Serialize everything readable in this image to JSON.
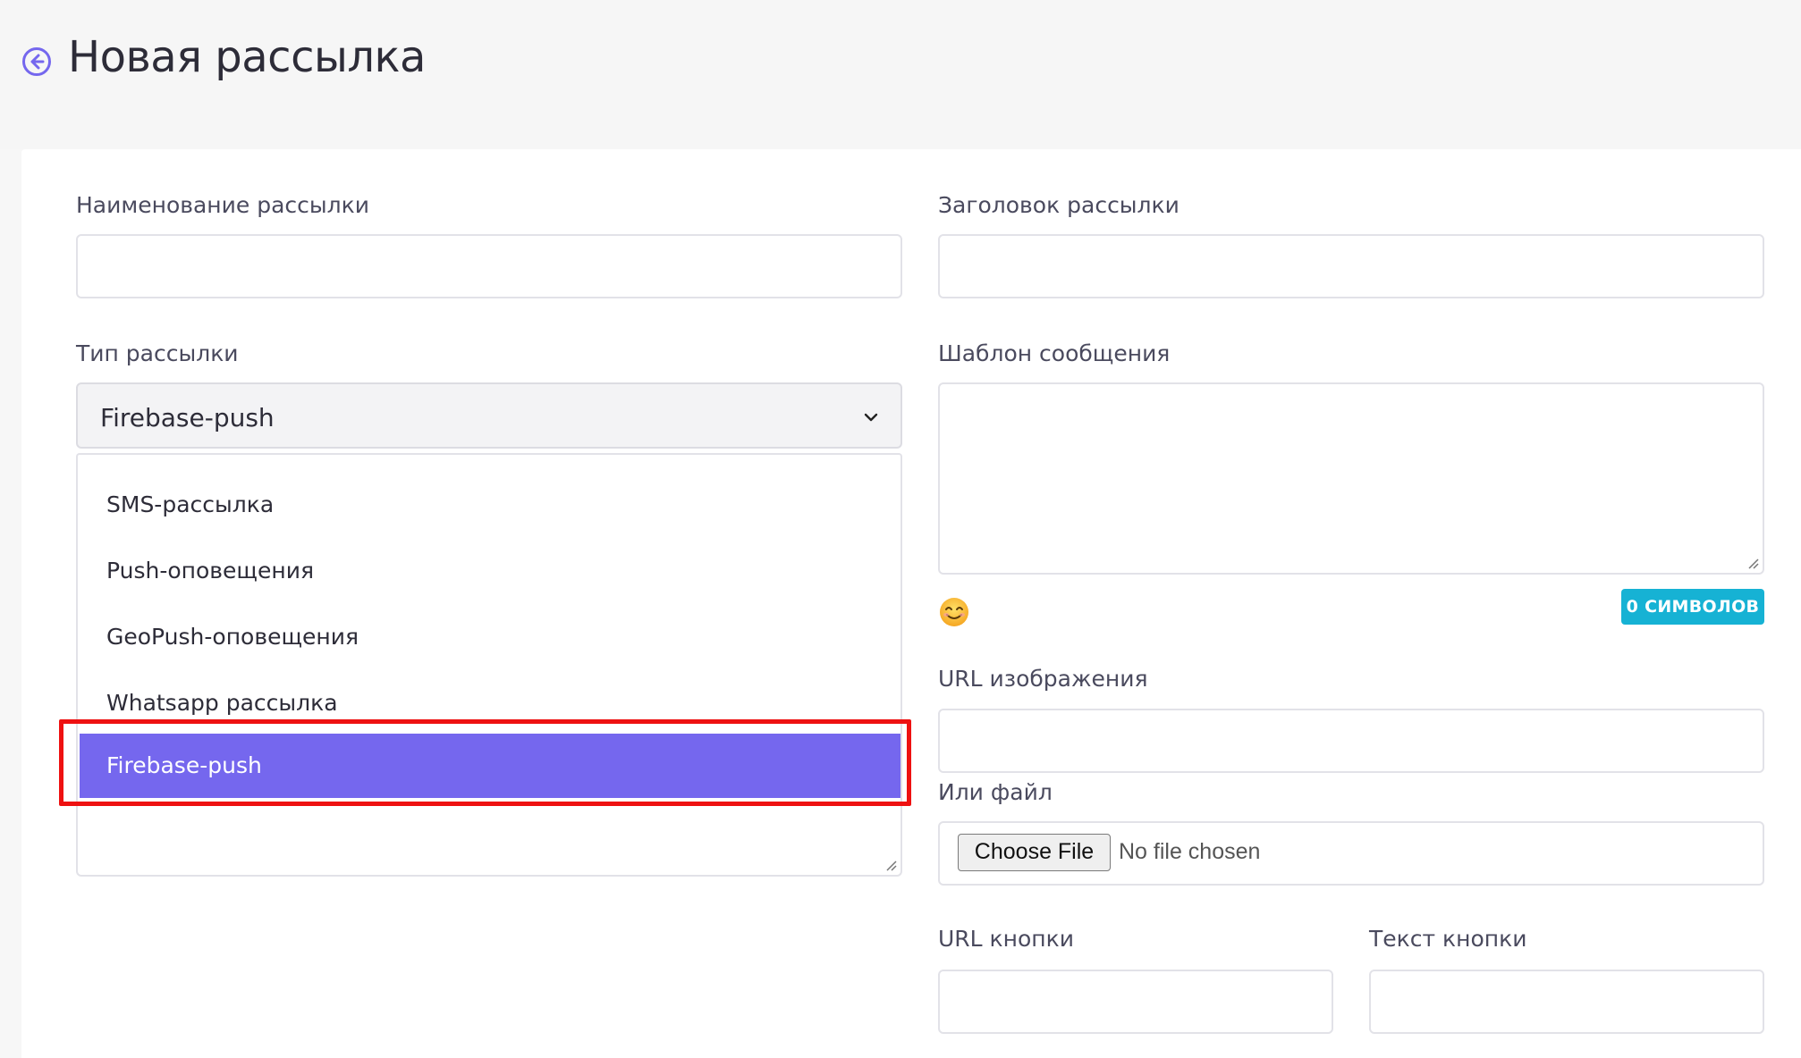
{
  "header": {
    "title": "Новая рассылка",
    "back_icon": "arrow-left-circle-icon",
    "accent": "#7567ee"
  },
  "form": {
    "name_label": "Наименование рассылки",
    "name_value": "",
    "heading_label": "Заголовок рассылки",
    "heading_value": "",
    "type_label": "Тип рассылки",
    "type_selected": "Firebase-push",
    "type_options": [
      {
        "label": "SMS-рассылка",
        "selected": false
      },
      {
        "label": "Push-оповещения",
        "selected": false
      },
      {
        "label": "GeoPush-оповещения",
        "selected": false
      },
      {
        "label": "Whatsapp рассылка",
        "selected": false
      },
      {
        "label": "Firebase-push",
        "selected": true
      }
    ],
    "template_label": "Шаблон сообщения",
    "template_value": "",
    "emoji_icon": "smiley-emoji-icon",
    "char_counter": "0 СИМВОЛОВ",
    "image_url_label": "URL изображения",
    "image_url_value": "",
    "file_label": "Или файл",
    "file_button": "Choose File",
    "file_status": "No file chosen",
    "button_url_label": "URL кнопки",
    "button_url_value": "",
    "button_text_label": "Текст кнопки",
    "button_text_value": ""
  },
  "colors": {
    "selected_option": "#7567ee",
    "highlight_border": "#ee1111",
    "counter_badge": "#16b2d4"
  }
}
